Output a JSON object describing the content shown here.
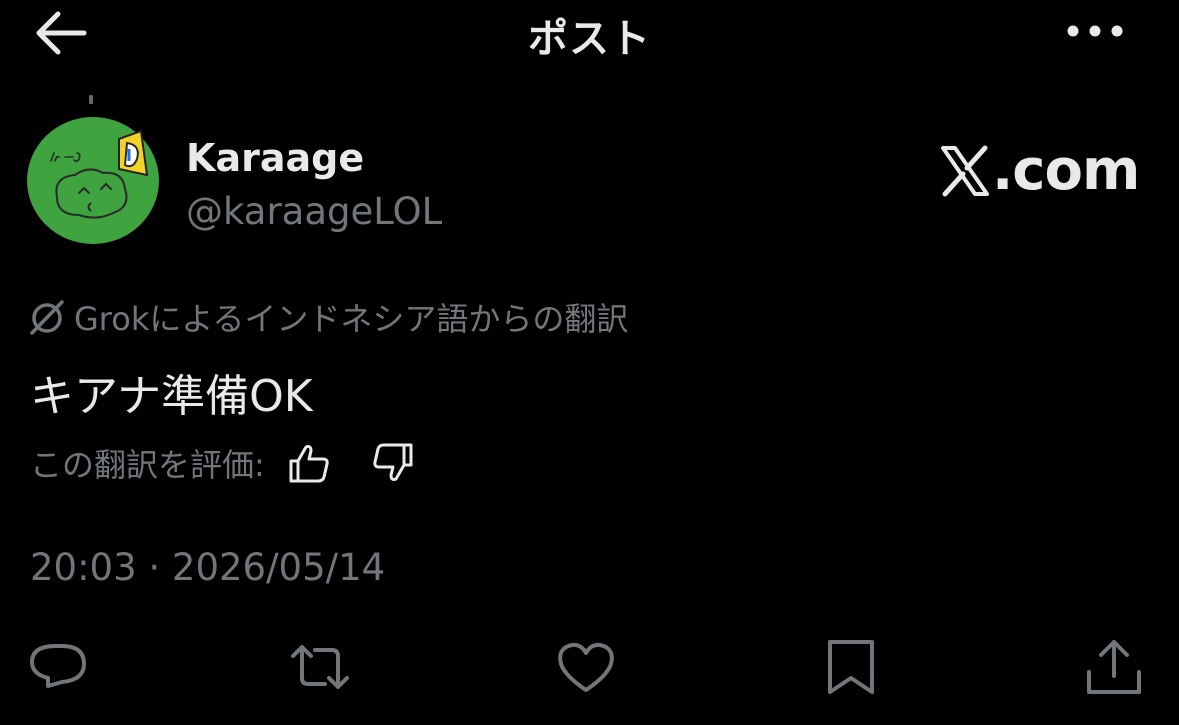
{
  "header": {
    "title": "ポスト",
    "back_icon": "arrow-left-icon",
    "more_icon": "more-horizontal-icon"
  },
  "author": {
    "name": "Karaage",
    "handle": "@karaageLOL",
    "avatar_icon": "avatar-drawing",
    "avatar_bg": "#3fa33f"
  },
  "brand": {
    "logo": "x-logo-icon",
    "suffix": ".com"
  },
  "translation": {
    "icon": "grok-icon",
    "label": "Grokによるインドネシア語からの翻訳"
  },
  "post": {
    "text": "キアナ準備OK"
  },
  "rating": {
    "label": "この翻訳を評価:",
    "up_icon": "thumbs-up-icon",
    "down_icon": "thumbs-down-icon"
  },
  "timestamp": "20:03 · 2026/05/14",
  "actions": [
    {
      "name": "reply",
      "icon": "reply-icon"
    },
    {
      "name": "repost",
      "icon": "repost-icon"
    },
    {
      "name": "like",
      "icon": "heart-icon"
    },
    {
      "name": "bookmark",
      "icon": "bookmark-icon"
    },
    {
      "name": "share",
      "icon": "share-icon"
    }
  ],
  "colors": {
    "background": "#000000",
    "primary_text": "#e7e9ea",
    "secondary_text": "#71767b"
  }
}
